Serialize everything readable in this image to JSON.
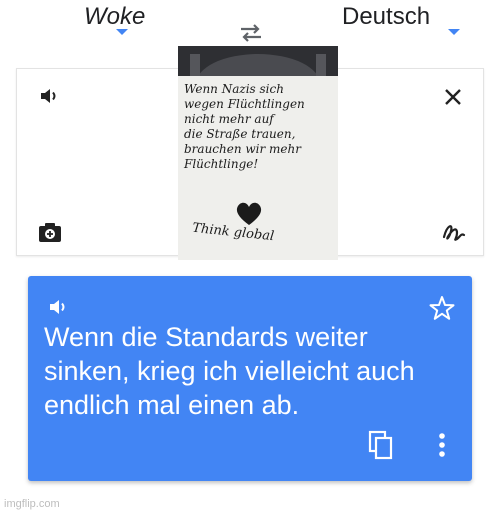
{
  "language_bar": {
    "source_language": "Woke",
    "target_language": "Deutsch"
  },
  "input": {
    "photo": {
      "sign_text": "Wenn Nazis sich\nwegen Flüchtlingen\nnicht mehr auf\ndie Straße trauen,\nbrauchen wir mehr\nFlüchtlinge!",
      "sign_footer": "Think global"
    },
    "icons": [
      "speaker-icon",
      "close-icon",
      "camera-icon",
      "handwriting-icon"
    ]
  },
  "translation": {
    "text": "Wenn die Standards weiter sinken, krieg ich vielleicht auch endlich mal einen ab.",
    "icons": [
      "speaker-icon",
      "star-icon",
      "copy-icon",
      "more-vert-icon"
    ]
  },
  "colors": {
    "accent": "#4285f4",
    "text": "#202124",
    "icon": "#333333"
  },
  "watermark": "imgflip.com"
}
